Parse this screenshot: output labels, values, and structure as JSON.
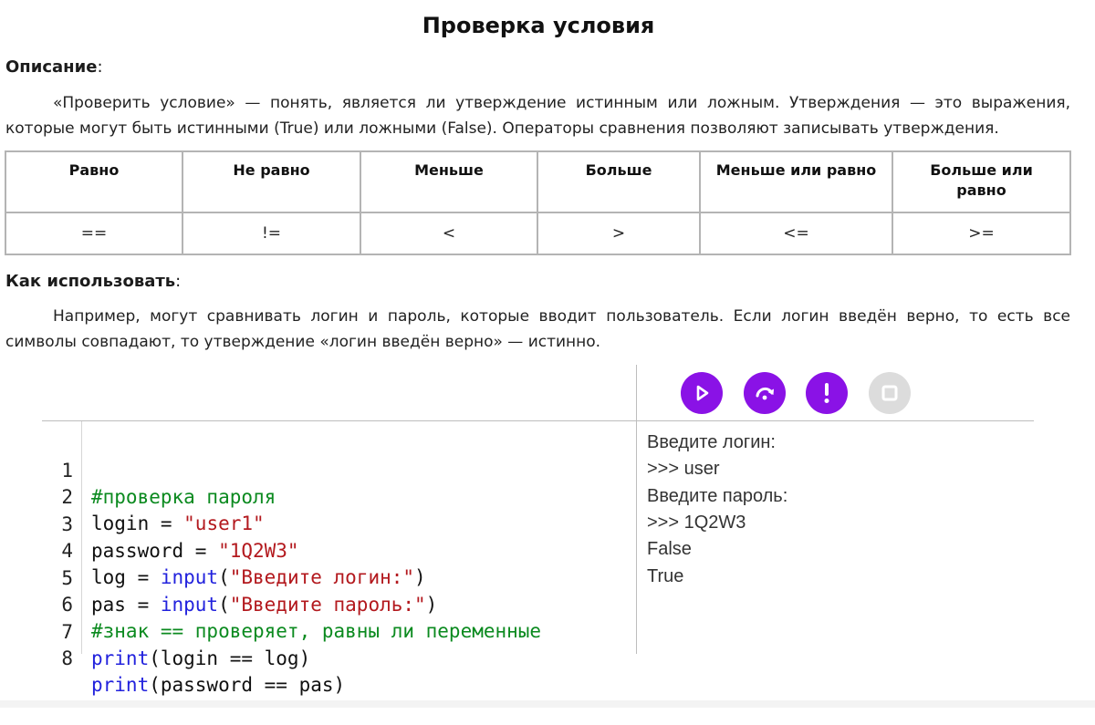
{
  "title": "Проверка условия",
  "description": {
    "heading": "Описание",
    "text": "«Проверить условие» — понять, является ли утверждение истинным или ложным. Утверждения — это выражения, которые могут быть истинными (True) или ложными (False). Операторы сравнения позволяют записывать утверждения."
  },
  "comparison_table": {
    "headers": [
      "Равно",
      "Не равно",
      "Меньше",
      "Больше",
      "Меньше или равно",
      "Больше или равно"
    ],
    "operators": [
      "==",
      "!=",
      "<",
      ">",
      "<=",
      ">="
    ]
  },
  "usage": {
    "heading": "Как использовать",
    "text": "Например, могут сравнивать логин и пароль, которые вводит пользователь. Если логин введён верно, то есть все символы совпадают, то утверждение «логин введён верно» — истинно."
  },
  "toolbar": {
    "buttons": [
      {
        "icon": "play-icon",
        "color": "#8a12e6"
      },
      {
        "icon": "step-over-icon",
        "color": "#8a12e6"
      },
      {
        "icon": "exclamation-icon",
        "color": "#8a12e6"
      },
      {
        "icon": "stop-icon",
        "color": "#dcdcdc"
      }
    ]
  },
  "code": {
    "line_numbers": [
      "1",
      "2",
      "3",
      "4",
      "5",
      "6",
      "7",
      "8"
    ],
    "l1": "#проверка пароля",
    "l2_a": "login = ",
    "l2_b": "\"user1\"",
    "l3_a": "password = ",
    "l3_b": "\"1Q2W3\"",
    "l4_a": "log = ",
    "l4_kw": "input",
    "l4_p1": "(",
    "l4_str": "\"Введите логин:\"",
    "l4_p2": ")",
    "l5_a": "pas = ",
    "l5_kw": "input",
    "l5_p1": "(",
    "l5_str": "\"Введите пароль:\"",
    "l5_p2": ")",
    "l6": "#знак == проверяет, равны ли переменные",
    "l7_kw": "print",
    "l7_rest": "(login == log)",
    "l8_kw": "print",
    "l8_rest": "(password == pas)"
  },
  "output": [
    "Введите логин:",
    ">>> user",
    "Введите пароль:",
    ">>> 1Q2W3",
    "False",
    "True"
  ],
  "colors": {
    "accent": "#8a12e6",
    "comment": "#0b8a1f",
    "string": "#b3191e",
    "keyword": "#2222dd"
  }
}
